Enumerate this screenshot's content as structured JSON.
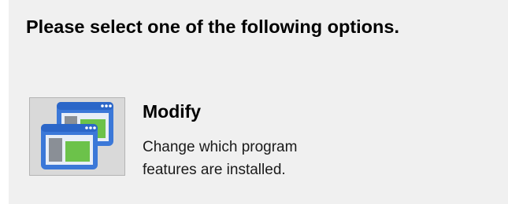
{
  "heading": "Please select one of the following options.",
  "options": [
    {
      "icon": "modify-windows-icon",
      "title": "Modify",
      "description": "Change which program features are installed."
    }
  ]
}
